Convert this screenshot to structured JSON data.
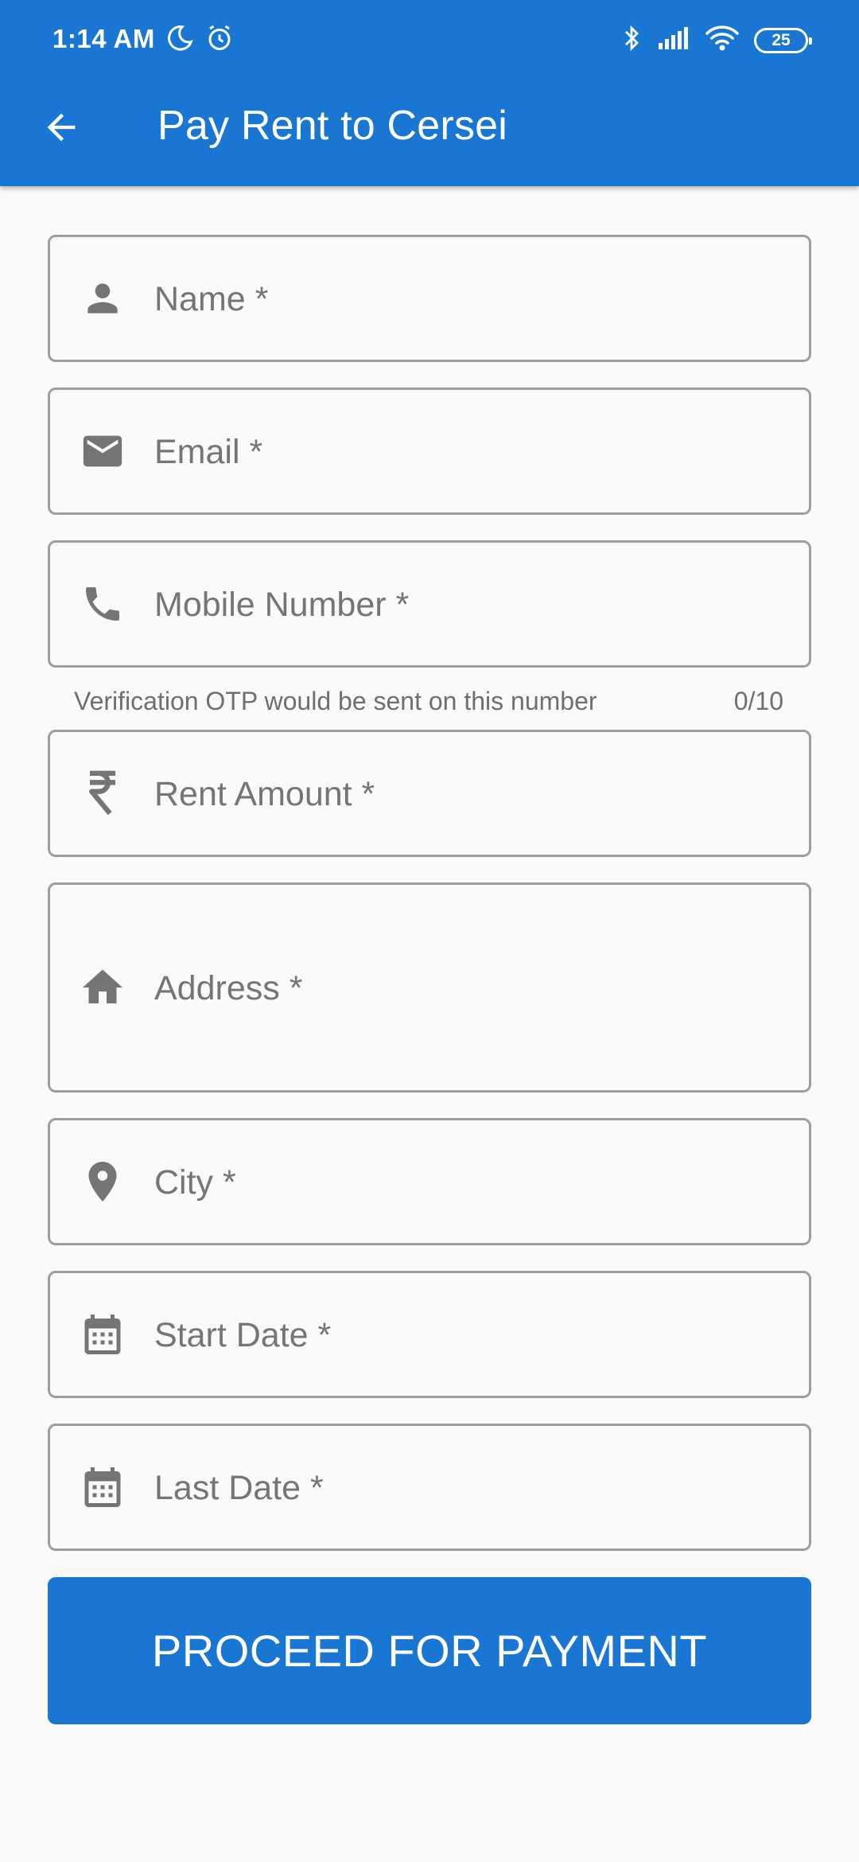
{
  "status_bar": {
    "time": "1:14 AM",
    "battery": "25",
    "icons": [
      "moon-icon",
      "alarm-icon",
      "bluetooth-icon",
      "signal-icon",
      "wifi-icon",
      "battery-icon"
    ]
  },
  "app_bar": {
    "title": "Pay Rent to Cersei",
    "back_icon": "arrow-back-icon",
    "color": "#1976d2"
  },
  "form": {
    "fields": [
      {
        "label": "Name *",
        "icon": "person-icon"
      },
      {
        "label": "Email *",
        "icon": "mail-icon"
      },
      {
        "label": "Mobile Number *",
        "icon": "phone-icon"
      },
      {
        "label": "Rent Amount *",
        "icon": "rupee-icon"
      },
      {
        "label": "Address *",
        "icon": "home-icon"
      },
      {
        "label": "City *",
        "icon": "location-pin-icon"
      },
      {
        "label": "Start Date *",
        "icon": "calendar-icon"
      },
      {
        "label": "Last Date *",
        "icon": "calendar-icon"
      }
    ],
    "mobile_helper": "Verification OTP would be sent on this number",
    "mobile_counter": "0/10"
  },
  "proceed_button": {
    "label": "PROCEED FOR PAYMENT"
  }
}
